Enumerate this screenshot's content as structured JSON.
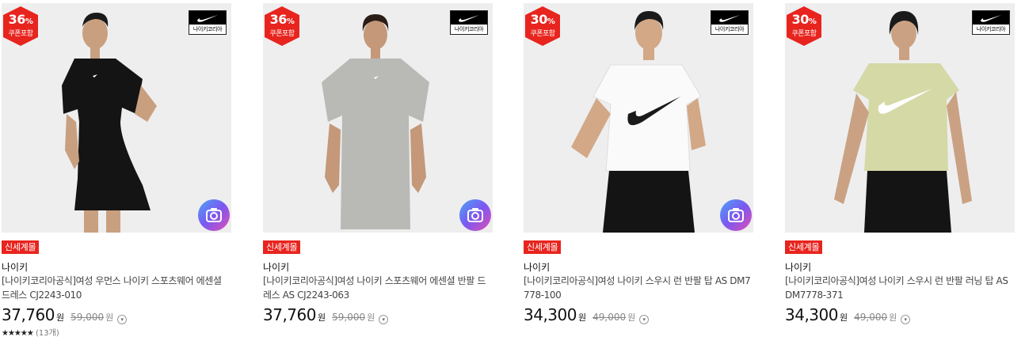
{
  "products": [
    {
      "discount": "36",
      "discount_unit": "%",
      "coupon": "쿠폰포함",
      "brand_logo_text": "나이키코리아",
      "tag": "신세계몰",
      "brand": "나이키",
      "title": "[나이키코리아공식]여성 우먼스 나이키 스포츠웨어 에센셜 드레스 CJ2243-010",
      "price": "37,760",
      "price_unit": "원",
      "original_price": "59,000",
      "original_unit": "원",
      "stars": "★★★★★",
      "review_count": "(13개)",
      "garment_color": "#141414",
      "has_review_button": true
    },
    {
      "discount": "36",
      "discount_unit": "%",
      "coupon": "쿠폰포함",
      "brand_logo_text": "나이키코리아",
      "tag": "신세계몰",
      "brand": "나이키",
      "title": "[나이키코리아공식]여성 나이키 스포츠웨어 에센셜 반팔 드레스 AS CJ2243-063",
      "price": "37,760",
      "price_unit": "원",
      "original_price": "59,000",
      "original_unit": "원",
      "garment_color": "#b9b9b6",
      "has_review_button": true
    },
    {
      "discount": "30",
      "discount_unit": "%",
      "coupon": "쿠폰포함",
      "brand_logo_text": "나이키코리아",
      "tag": "신세계몰",
      "brand": "나이키",
      "title": "[나이키코리아공식]여성 나이키 스우시 런 반팔 탑 AS DM7778-100",
      "price": "34,300",
      "price_unit": "원",
      "original_price": "49,000",
      "original_unit": "원",
      "garment_color": "#fafafa",
      "has_review_button": true
    },
    {
      "discount": "30",
      "discount_unit": "%",
      "coupon": "쿠폰포함",
      "brand_logo_text": "나이키코리아",
      "tag": "신세계몰",
      "brand": "나이키",
      "title": "[나이키코리아공식]여성 나이키 스우시 런 반팔 러닝 탑 AS DM7778-371",
      "price": "34,300",
      "price_unit": "원",
      "original_price": "49,000",
      "original_unit": "원",
      "garment_color": "#d4d9a6",
      "has_review_button": false
    }
  ],
  "colors": {
    "badge_red": "#e8241e",
    "thumb_bg": "#eeeeef",
    "skin": "#c9a07f",
    "legging": "#141414"
  }
}
